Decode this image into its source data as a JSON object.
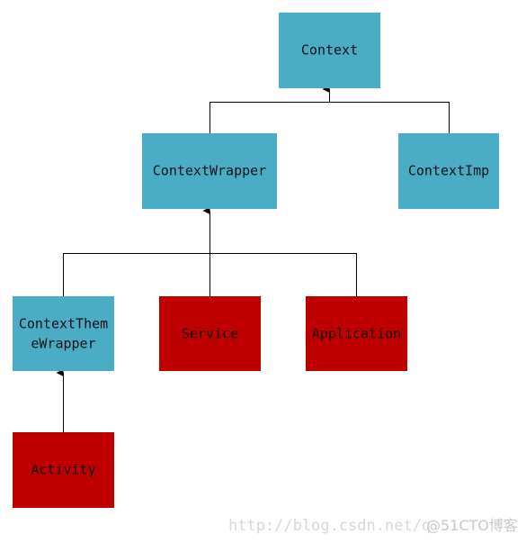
{
  "colors": {
    "context_class": "#4bacc6",
    "component_class": "#c00000",
    "line": "#000000"
  },
  "nodes": {
    "context": "Context",
    "context_wrapper": "ContextWrapper",
    "context_imp": "ContextImp",
    "context_theme_wrapper_line1": "ContextThem",
    "context_theme_wrapper_line2": "eWrapper",
    "service": "Service",
    "application": "Application",
    "activity": "Activity"
  },
  "edges": [
    {
      "from": "ContextWrapper",
      "to": "Context"
    },
    {
      "from": "ContextImp",
      "to": "Context"
    },
    {
      "from": "ContextThemeWrapper",
      "to": "ContextWrapper"
    },
    {
      "from": "Service",
      "to": "ContextWrapper"
    },
    {
      "from": "Application",
      "to": "ContextWrapper"
    },
    {
      "from": "Activity",
      "to": "ContextThemeWrapper"
    }
  ],
  "watermark": {
    "url": "http://blog.csdn.net/q",
    "brand": "@51CTO博客"
  }
}
